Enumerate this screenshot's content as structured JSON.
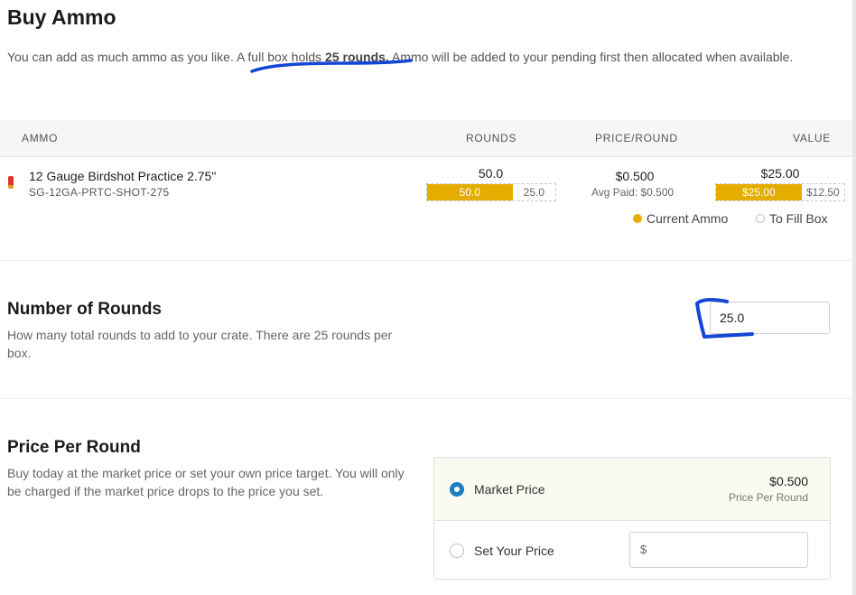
{
  "page": {
    "title": "Buy Ammo",
    "intro_before": "You can add as much ammo as you like. A full box holds ",
    "intro_bold": "25 rounds.",
    "intro_after": " Ammo will be added to your pending first then allocated when available."
  },
  "table": {
    "headers": {
      "ammo": "AMMO",
      "rounds": "ROUNDS",
      "price_round": "PRICE/ROUND",
      "value": "VALUE"
    },
    "row": {
      "name": "12 Gauge Birdshot Practice 2.75\"",
      "sku": "SG-12GA-PRTC-SHOT-275",
      "rounds_total": "50.0",
      "rounds_current": "50.0",
      "rounds_fill": "25.0",
      "rounds_current_fraction": 0.667,
      "price": "$0.500",
      "avg_paid": "Avg Paid: $0.500",
      "value_total": "$25.00",
      "value_current": "$25.00",
      "value_fill": "$12.50",
      "value_current_fraction": 0.667
    },
    "legend": {
      "current": "Current Ammo",
      "fill": "To Fill Box"
    }
  },
  "rounds_section": {
    "title": "Number of Rounds",
    "description": "How many total rounds to add to your crate. There are 25 rounds per box.",
    "input_value": "25.0"
  },
  "price_section": {
    "title": "Price Per Round",
    "description": "Buy today at the market price or set your own price target. You will only be charged if the market price drops to the price you set.",
    "market_label": "Market Price",
    "market_price": "$0.500",
    "market_sub": "Price Per Round",
    "set_label": "Set Your Price",
    "currency_prefix": "$"
  },
  "colors": {
    "accent_bar": "#e4ad00",
    "radio_selected": "#1a7fc1",
    "annotation": "#1446d6"
  }
}
